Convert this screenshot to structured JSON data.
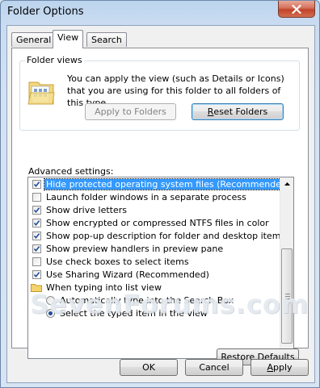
{
  "window": {
    "title": "Folder Options",
    "close_label": "close"
  },
  "tabs": [
    {
      "label": "General",
      "active": false
    },
    {
      "label": "View",
      "active": true
    },
    {
      "label": "Search",
      "active": false
    }
  ],
  "folder_views": {
    "caption": "Folder views",
    "description": "You can apply the view (such as Details or Icons) that you are using for this folder to all folders of this type.",
    "apply_label": "Apply to Folders",
    "reset_label": "Reset Folders",
    "reset_accel": "R",
    "reset_rest": "eset Folders"
  },
  "advanced": {
    "label": "Advanced settings:",
    "items": [
      {
        "type": "checkbox",
        "label": "Hide protected operating system files (Recommended)",
        "checked": true,
        "selected": true
      },
      {
        "type": "checkbox",
        "label": "Launch folder windows in a separate process",
        "checked": false
      },
      {
        "type": "checkbox",
        "label": "Show drive letters",
        "checked": true
      },
      {
        "type": "checkbox",
        "label": "Show encrypted or compressed NTFS files in color",
        "checked": true
      },
      {
        "type": "checkbox",
        "label": "Show pop-up description for folder and desktop items",
        "checked": true
      },
      {
        "type": "checkbox",
        "label": "Show preview handlers in preview pane",
        "checked": true
      },
      {
        "type": "checkbox",
        "label": "Use check boxes to select items",
        "checked": false
      },
      {
        "type": "checkbox",
        "label": "Use Sharing Wizard (Recommended)",
        "checked": true
      },
      {
        "type": "folder",
        "label": "When typing into list view"
      },
      {
        "type": "radio",
        "label": "Automatically type into the Search Box",
        "checked": false
      },
      {
        "type": "radio",
        "label": "Select the typed item in the view",
        "checked": true
      }
    ]
  },
  "restore_defaults": {
    "label": "Restore Defaults",
    "pre": "Restore ",
    "accel": "D",
    "post": "efaults"
  },
  "watermark": "SevenForums.com",
  "footer": {
    "ok_label": "OK",
    "cancel_label": "Cancel",
    "apply_label": "Apply",
    "apply_accel": "A",
    "apply_rest": "pply"
  },
  "colors": {
    "selection": "#3399ff",
    "check": "#1f4d9b",
    "close_button": "#c0432a"
  }
}
